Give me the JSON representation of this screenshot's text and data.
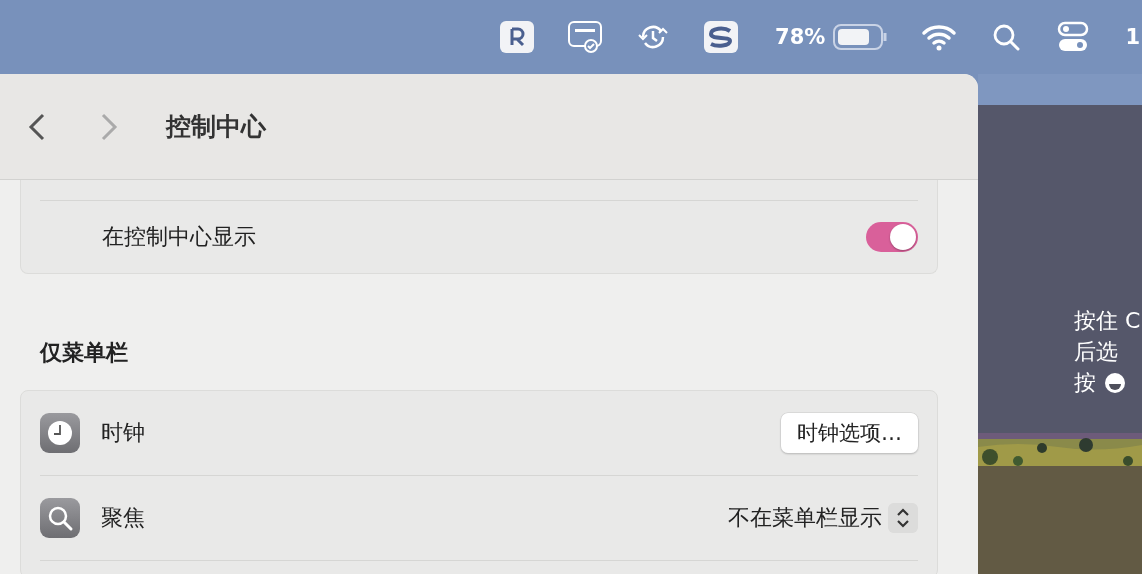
{
  "menu_bar": {
    "battery_percent": "78%",
    "clock_partial": "1"
  },
  "window": {
    "title": "控制中心",
    "back_disabled": false,
    "forward_disabled": true
  },
  "top_card": {
    "rows": [
      {
        "label": "在控制中心显示",
        "kind": "toggle",
        "on": true
      }
    ]
  },
  "section": {
    "title": "仅菜单栏",
    "rows": [
      {
        "label": "时钟",
        "kind": "button",
        "button": "时钟选项…"
      },
      {
        "label": "聚焦",
        "kind": "popup",
        "value": "不在菜单栏显示"
      }
    ]
  },
  "desktop": {
    "lines": [
      {
        "kind": "text",
        "text": "按住 C"
      },
      {
        "kind": "text",
        "text": "后选"
      },
      {
        "kind": "text-with-emoji",
        "text": "按"
      }
    ]
  }
}
